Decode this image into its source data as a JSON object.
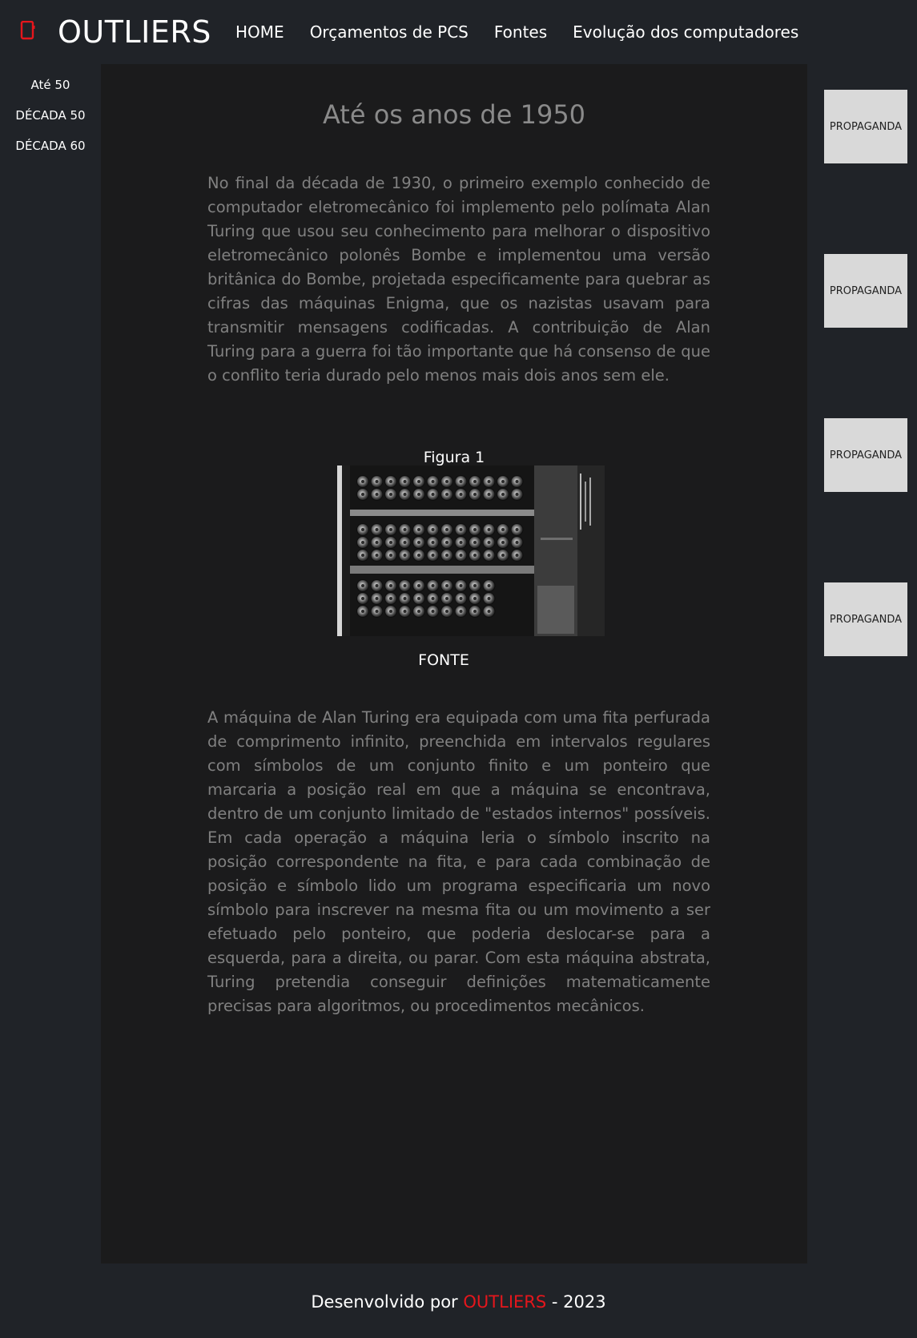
{
  "header": {
    "logo_text": "OUTLIERS",
    "nav": [
      {
        "label": "HOME"
      },
      {
        "label": "Orçamentos de PCS"
      },
      {
        "label": "Fontes"
      },
      {
        "label": "Evolução dos computadores"
      }
    ]
  },
  "sidebar": {
    "items": [
      {
        "label": "Até 50"
      },
      {
        "label": "DÉCADA 50"
      },
      {
        "label": "DÉCADA 60"
      }
    ]
  },
  "main": {
    "title": "Até os anos de 1950",
    "paragraph_1": "No final da década de 1930, o primeiro exemplo conhecido de computador eletromecânico foi implemento pelo polímata Alan Turing que usou seu conhecimento para melhorar o dispositivo eletromecânico polonês Bombe e implementou uma versão britânica do Bombe, projetada especificamente para quebrar as cifras das máquinas Enigma, que os nazistas usavam para transmitir mensagens codificadas. A contribuição de Alan Turing para a guerra foi tão importante que há consenso de que o conflito teria durado pelo menos mais dois anos sem ele.",
    "figure": {
      "caption": "Figura 1",
      "source_label": "FONTE"
    },
    "paragraph_2": "A máquina de Alan Turing era equipada com uma fita perfurada de comprimento infinito, preenchida em intervalos regulares com símbolos de um conjunto finito e um ponteiro que marcaria a posição real em que a máquina se encontrava, dentro de um conjunto limitado de \"estados internos\" possíveis. Em cada operação a máquina leria o símbolo inscrito na posição correspondente na fita, e para cada combinação de posição e símbolo lido um programa especificaria um novo símbolo para inscrever na mesma fita ou um movimento a ser efetuado pelo ponteiro, que poderia deslocar-se para a esquerda, para a direita, ou parar. Com esta máquina abstrata, Turing pretendia conseguir definições matematicamente precisas para algoritmos, ou procedimentos mecânicos."
  },
  "ads": [
    {
      "label": "PROPAGANDA"
    },
    {
      "label": "PROPAGANDA"
    },
    {
      "label": "PROPAGANDA"
    },
    {
      "label": "PROPAGANDA"
    }
  ],
  "footer": {
    "prefix": "Desenvolvido por",
    "brand": "OUTLIERS",
    "suffix": "- 2023"
  },
  "colors": {
    "background": "#202328",
    "main_background": "#1b1b1c",
    "accent": "#e5161c",
    "body_text": "#808080",
    "ad_background": "#d9d9d9"
  },
  "icons": {
    "logo": "phone-icon"
  }
}
